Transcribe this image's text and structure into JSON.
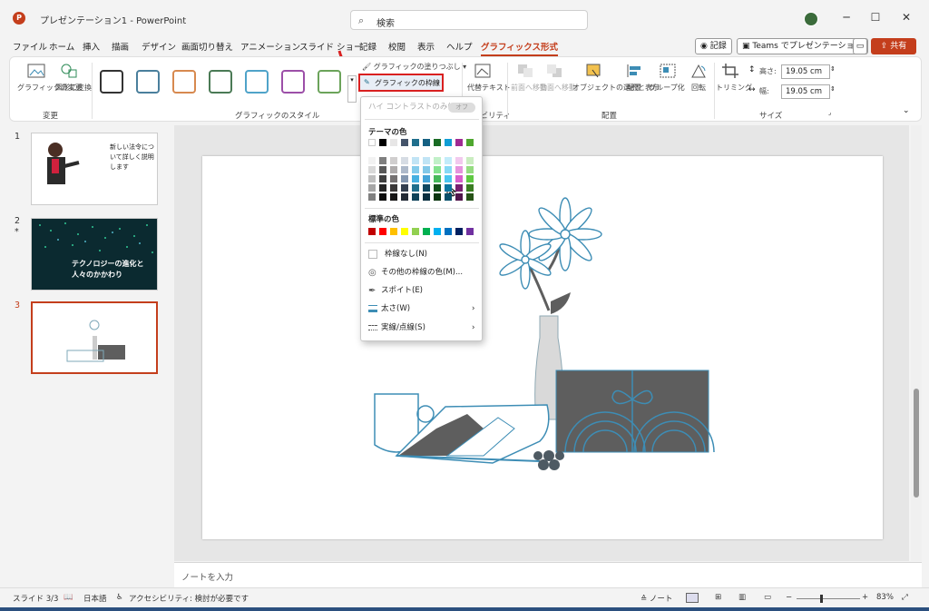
{
  "window": {
    "title": "プレゼンテーション1 - PowerPoint",
    "search_placeholder": "検索",
    "app_logo": "P"
  },
  "menu": {
    "items": [
      "ファイル",
      "ホーム",
      "挿入",
      "描画",
      "デザイン",
      "画面切り替え",
      "アニメーション",
      "スライド ショー",
      "記録",
      "校閲",
      "表示",
      "ヘルプ",
      "グラフィックス形式"
    ],
    "record_button": "記録",
    "teams_button": "Teams でプレゼンテーション",
    "share_button": "共有"
  },
  "ribbon": {
    "change_graphic": "グラフィックの変更",
    "convert_shape": "図形に変換",
    "group_change": "変更",
    "group_style": "グラフィックのスタイル",
    "fill_button": "グラフィックの塗りつぶし",
    "outline_button": "グラフィックの枠線",
    "alt_text": "代替テキスト",
    "accessibility_partial": "シビリティ",
    "bring_forward": "前面へ移動",
    "send_backward": "背面へ移動",
    "selection_pane": "オブジェクトの選択と表示",
    "align": "配置",
    "group": "グループ化",
    "rotate": "回転",
    "group_arrange": "配置",
    "crop": "トリミング",
    "height_label": "高さ:",
    "height_value": "19.05 cm",
    "width_label": "幅:",
    "width_value": "19.05 cm",
    "group_size": "サイズ",
    "style_colors": [
      "#333333",
      "#4a7f9c",
      "#d7894f",
      "#4a7a55",
      "#4fa3c9",
      "#9c4fa8",
      "#6ba35a"
    ]
  },
  "dropdown": {
    "high_contrast": "ハイ コントラストのみ(H)",
    "toggle_state": "オフ",
    "theme_colors_title": "テーマの色",
    "standard_colors_title": "標準の色",
    "no_outline": "枠線なし(N)",
    "more_colors": "その他の枠線の色(M)...",
    "eyedropper": "スポイト(E)",
    "weight": "太さ(W)",
    "dashes": "実線/点線(S)",
    "theme_top_row": [
      "#ffffff",
      "#000000",
      "#e7e6e6",
      "#44546a",
      "#1f6e8c",
      "#156082",
      "#196b24",
      "#0f9ed5",
      "#a02b93",
      "#4ea72e"
    ],
    "theme_columns": [
      [
        "#f2f2f2",
        "#d9d9d9",
        "#bfbfbf",
        "#a6a6a6",
        "#808080"
      ],
      [
        "#7f7f7f",
        "#595959",
        "#404040",
        "#262626",
        "#0d0d0d"
      ],
      [
        "#d0cece",
        "#aeabab",
        "#757171",
        "#3a3838",
        "#171616"
      ],
      [
        "#d6dce4",
        "#adb9ca",
        "#8497b0",
        "#333f4f",
        "#222a35"
      ],
      [
        "#c1e4f5",
        "#83cbeb",
        "#45b0e1",
        "#1f6e8c",
        "#0e4259"
      ],
      [
        "#c0e4f5",
        "#82c8e8",
        "#44a4d8",
        "#0f4761",
        "#0a2f40"
      ],
      [
        "#c1f0c8",
        "#83e28e",
        "#46b95a",
        "#12501a",
        "#0b3510"
      ],
      [
        "#c2ecfa",
        "#86d9f5",
        "#4bc6ef",
        "#0b76a0",
        "#074f6a"
      ],
      [
        "#f2c9ee",
        "#e593dd",
        "#d85fcc",
        "#782070",
        "#50154b"
      ],
      [
        "#caedc0",
        "#95dc81",
        "#5fc842",
        "#3a7d22",
        "#275317"
      ]
    ],
    "standard_colors": [
      "#c00000",
      "#ff0000",
      "#ffc000",
      "#ffff00",
      "#92d050",
      "#00b050",
      "#00b0f0",
      "#0070c0",
      "#002060",
      "#7030a0"
    ]
  },
  "slides": {
    "thumb1_text": "新しい法令について詳しく説明します",
    "thumb2_text": "テクノロジーの進化と人々のかかわり",
    "numbers": [
      "1",
      "2",
      "3"
    ],
    "thumb2_marker": "*"
  },
  "notes_placeholder": "ノートを入力",
  "status": {
    "slide_count": "スライド 3/3",
    "language": "日本語",
    "accessibility": "アクセシビリティ: 検討が必要です",
    "notes": "ノート",
    "zoom": "83%"
  },
  "colors": {
    "accent": "#c43e1c",
    "illustration_dark": "#5e5e5e",
    "illustration_blue": "#3d8db5"
  }
}
